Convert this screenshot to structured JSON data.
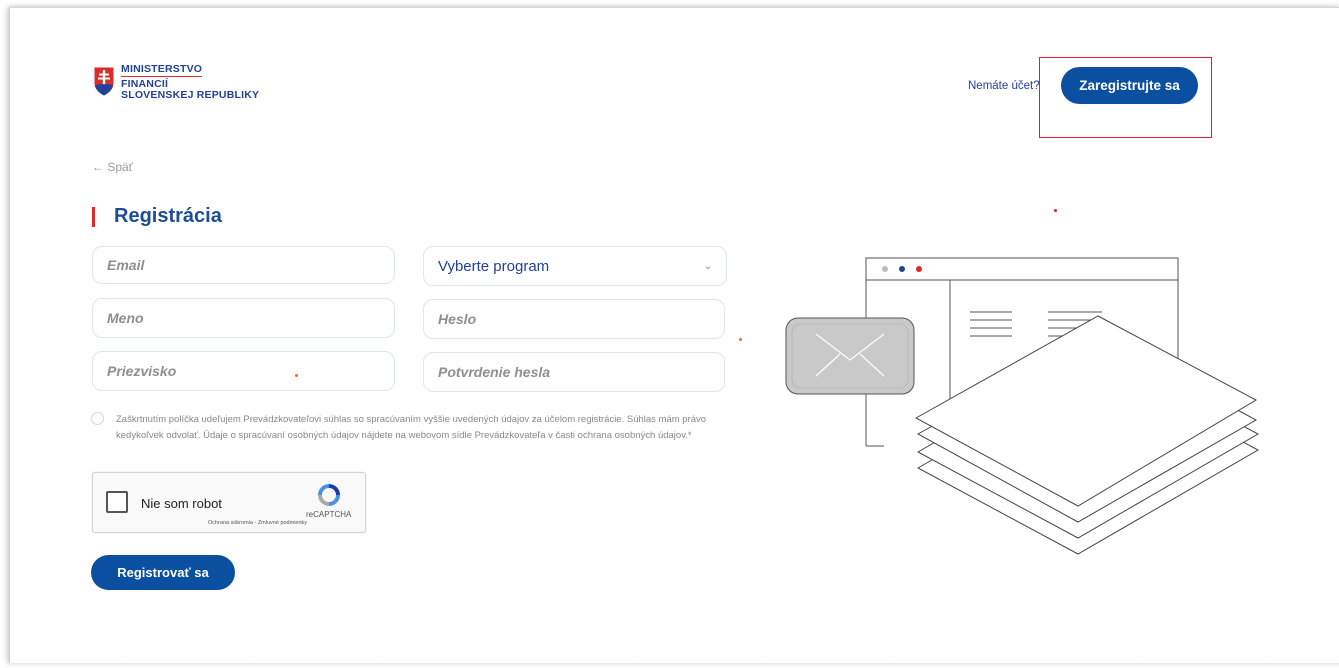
{
  "header": {
    "logo": {
      "line1": "MINISTERSTVO",
      "line2": "FINANCIÍ",
      "line3": "SLOVENSKEJ REPUBLIKY"
    },
    "no_account_text": "Nemáte účet?",
    "register_button_label": "Zaregistrujte sa"
  },
  "nav": {
    "back_label": "← Späť"
  },
  "form": {
    "title": "Registrácia",
    "email_placeholder": "Email",
    "name_placeholder": "Meno",
    "surname_placeholder": "Priezvisko",
    "program_select_value": "Vyberte program",
    "password_placeholder": "Heslo",
    "password_confirm_placeholder": "Potvrdenie hesla",
    "consent_text": "Zaškrtnutím políčka udeľujem Prevádzkovateľovi súhlas so spracúvaním vyššie uvedených údajov za účelom registrácie. Súhlas mám právo kedykoľvek odvolať. Údaje o spracúvaní osobných údajov nájdete na webovom sídle Prevádzkovateľa v časti ochrana osobných údajov.*",
    "captcha": {
      "label": "Nie som robot",
      "brand": "reCAPTCHA",
      "links": "Ochrana súkromia - Zmluvné podmienky"
    },
    "submit_label": "Registrovať sa"
  },
  "colors": {
    "primary": "#0b4fa0",
    "accent_red": "#d92d27",
    "title_blue": "#1d4d96"
  }
}
